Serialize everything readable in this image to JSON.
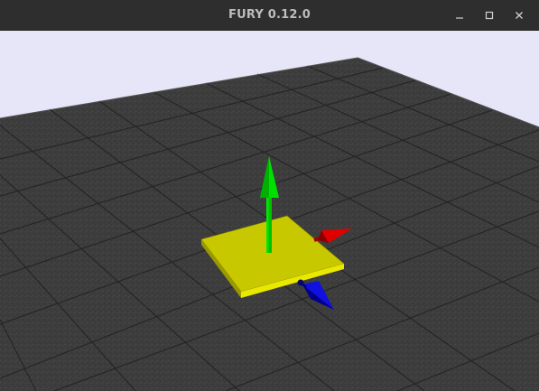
{
  "window": {
    "title": "FURY 0.12.0",
    "controls": {
      "minimize_icon": "minimize-icon",
      "maximize_icon": "maximize-icon",
      "close_icon": "close-icon"
    }
  },
  "scene": {
    "background_color": "#e6e6f8",
    "floor_color": "#3d3d3d",
    "grid_line_color": "#222222",
    "plane_color": "#e6e600",
    "axes": [
      {
        "name": "y-axis-arrow",
        "color": "#00dd00"
      },
      {
        "name": "x-axis-arrow",
        "color": "#dd0000"
      },
      {
        "name": "z-axis-arrow",
        "color": "#0000dd"
      }
    ]
  }
}
